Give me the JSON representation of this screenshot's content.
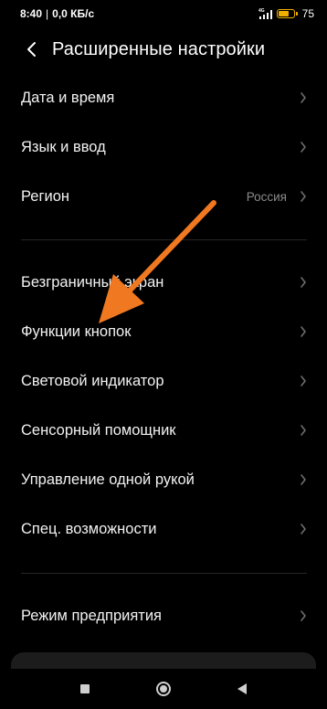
{
  "status_bar": {
    "time": "8:40",
    "separator": "|",
    "network_speed": "0,0 КБ/с",
    "network_type": "4G",
    "battery_level": "75",
    "battery_fraction": 0.75,
    "icons": [
      "signal-icon",
      "battery-icon"
    ]
  },
  "header": {
    "title": "Расширенные настройки",
    "back_icon": "chevron-left-icon"
  },
  "settings": {
    "group1": [
      {
        "label": "Дата и время",
        "value": ""
      },
      {
        "label": "Язык и ввод",
        "value": ""
      },
      {
        "label": "Регион",
        "value": "Россия"
      }
    ],
    "group2": [
      {
        "label": "Безграничный экран",
        "value": ""
      },
      {
        "label": "Функции кнопок",
        "value": ""
      },
      {
        "label": "Световой индикатор",
        "value": ""
      },
      {
        "label": "Сенсорный помощник",
        "value": ""
      },
      {
        "label": "Управление одной рукой",
        "value": ""
      },
      {
        "label": "Спец. возможности",
        "value": ""
      }
    ],
    "group3": [
      {
        "label": "Режим предприятия",
        "value": ""
      }
    ]
  },
  "nav_bar": {
    "icons": [
      "recent-apps-icon",
      "home-icon",
      "back-icon"
    ]
  },
  "colors": {
    "background": "#000000",
    "text": "#f2f2f2",
    "secondary_text": "#8a8a8a",
    "battery": "#f0b000",
    "annotation_arrow": "#f07820"
  }
}
